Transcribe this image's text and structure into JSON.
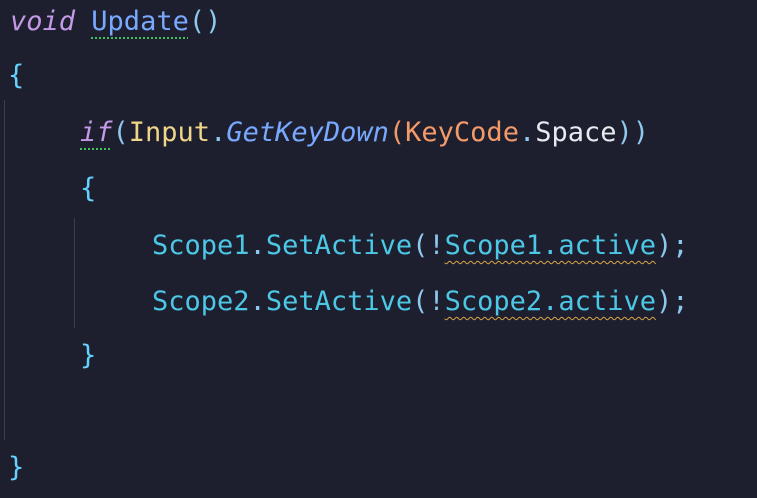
{
  "code": {
    "line1": {
      "kw": "void",
      "space": " ",
      "fn": "Update",
      "parens": "()"
    },
    "line2": {
      "brace": "{"
    },
    "line3": {
      "kw": "if",
      "open": "(",
      "cls": "Input",
      "dot1": ".",
      "method": "GetKeyDown",
      "open2": "(",
      "enum": "KeyCode",
      "dot2": ".",
      "member": "Space",
      "close": "))"
    },
    "line4": {
      "brace": "{"
    },
    "line5": {
      "obj": "Scope1",
      "dot1": ".",
      "method": "SetActive",
      "open": "(!",
      "arg": "Scope1.active",
      "close": ");"
    },
    "line6": {
      "obj": "Scope2",
      "dot1": ".",
      "method": "SetActive",
      "open": "(!",
      "arg": "Scope2.active",
      "close": ");"
    },
    "line7": {
      "brace": "}"
    },
    "line9": {
      "brace": "}"
    }
  },
  "colors": {
    "background": "#1e1f2e",
    "keyword": "#c49ae8",
    "function": "#78a9ff",
    "class": "#f0d68a",
    "enum": "#f39a6a",
    "identifier": "#4dc7e6",
    "warning_underline": "#d9a646",
    "hint_underline": "#3fc260"
  }
}
